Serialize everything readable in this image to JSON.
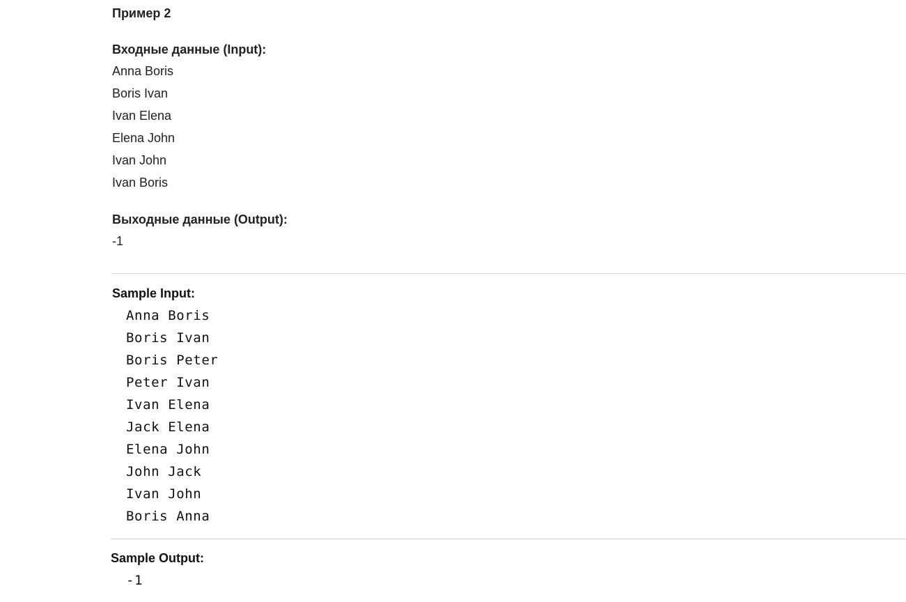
{
  "example": {
    "title": "Пример 2",
    "input_heading": "Входные данные (Input):",
    "input_lines": [
      "Anna Boris",
      "Boris Ivan",
      "Ivan Elena",
      "Elena John",
      "Ivan John",
      "Ivan Boris"
    ],
    "output_heading": "Выходные данные (Output):",
    "output_lines": [
      "-1"
    ]
  },
  "sample": {
    "input_heading": "Sample Input:",
    "input_lines": [
      "Anna Boris",
      "Boris Ivan",
      "Boris Peter",
      "Peter Ivan",
      "Ivan Elena",
      "Jack Elena",
      "Elena John",
      "John Jack",
      "Ivan John",
      "Boris Anna"
    ],
    "output_heading": "Sample Output:",
    "output_lines": [
      "-1"
    ]
  }
}
